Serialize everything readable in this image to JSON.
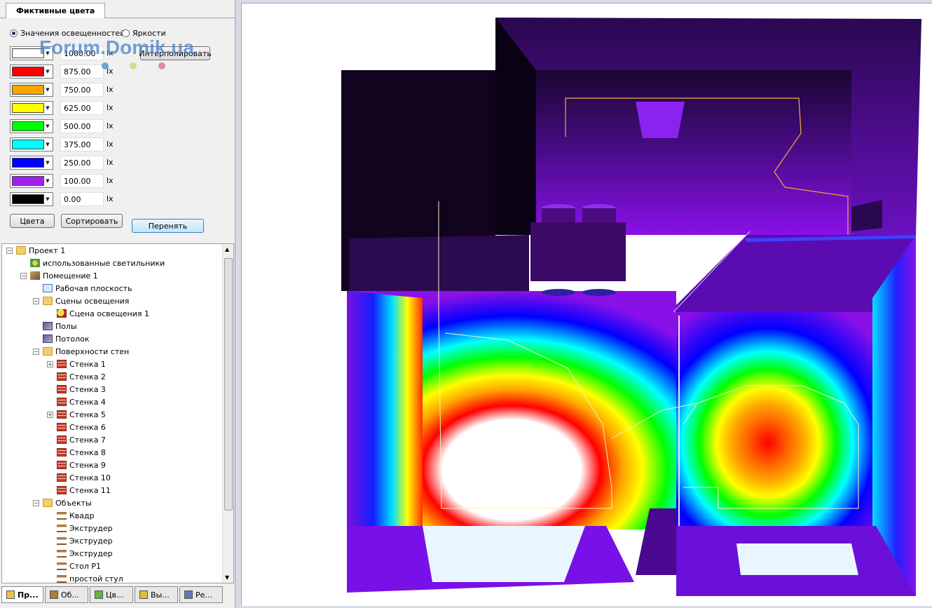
{
  "tab_title": "Фиктивные цвета",
  "radio": {
    "option1": "Значения освещенностей",
    "option2": "Яркости"
  },
  "colors": [
    {
      "color": "#ffffff",
      "value": "1000.00",
      "unit": "lx"
    },
    {
      "color": "#ff0000",
      "value": "875.00",
      "unit": "lx"
    },
    {
      "color": "#ffa500",
      "value": "750.00",
      "unit": "lx"
    },
    {
      "color": "#ffff00",
      "value": "625.00",
      "unit": "lx"
    },
    {
      "color": "#00ff00",
      "value": "500.00",
      "unit": "lx"
    },
    {
      "color": "#00ffff",
      "value": "375.00",
      "unit": "lx"
    },
    {
      "color": "#0000ff",
      "value": "250.00",
      "unit": "lx"
    },
    {
      "color": "#a020f0",
      "value": "100.00",
      "unit": "lx"
    },
    {
      "color": "#000000",
      "value": "0.00",
      "unit": "lx"
    }
  ],
  "buttons": {
    "interpolate": "Интерполировать",
    "colors": "Цвета",
    "sort": "Сортировать",
    "apply": "Перенять"
  },
  "watermark": "Forum.Domik.ua",
  "tree": {
    "project": "Проект 1",
    "luminaires": "использованные светильники",
    "room": "Помещение 1",
    "workplane": "Рабочая плоскость",
    "scenes": "Сцены освещения",
    "scene1": "Сцена освещения 1",
    "floors": "Полы",
    "ceiling": "Потолок",
    "walls": "Поверхности стен",
    "wall_items": [
      "Стенка 1",
      "Стенка 2",
      "Стенка 3",
      "Стенка 4",
      "Стенка 5",
      "Стенка 6",
      "Стенка 7",
      "Стенка 8",
      "Стенка 9",
      "Стенка 10",
      "Стенка 11"
    ],
    "objects": "Объекты",
    "object_items": [
      "Квадр",
      "Экструдер",
      "Экструдер",
      "Экструдер",
      "Стол P1",
      "простой стул"
    ]
  },
  "bottom_tabs": [
    "Пр...",
    "Об...",
    "Цв...",
    "Вы...",
    "Ре..."
  ]
}
